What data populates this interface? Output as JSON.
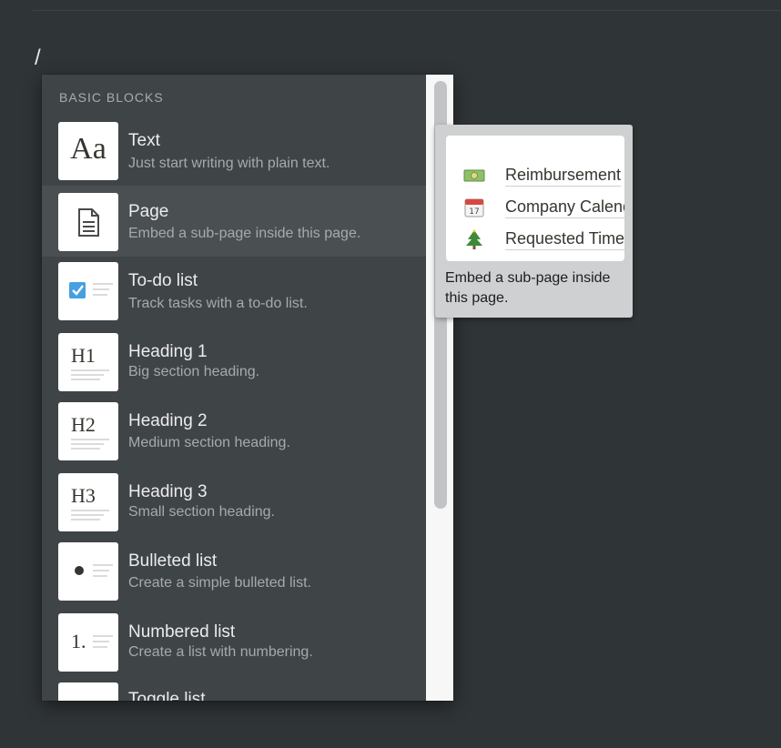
{
  "editor": {
    "slash_text": "/"
  },
  "menu": {
    "section_title": "BASIC BLOCKS",
    "items": [
      {
        "id": "text",
        "label": "Text",
        "description": "Just start writing with plain text.",
        "icon": "text-aa-icon"
      },
      {
        "id": "page",
        "label": "Page",
        "description": "Embed a sub-page inside this page.",
        "icon": "page-document-icon",
        "active": true
      },
      {
        "id": "todo",
        "label": "To-do list",
        "description": "Track tasks with a to-do list.",
        "icon": "checkbox-icon"
      },
      {
        "id": "heading1",
        "label": "Heading 1",
        "description": "Big section heading.",
        "icon": "heading-1-icon",
        "glyph": "H1"
      },
      {
        "id": "heading2",
        "label": "Heading 2",
        "description": "Medium section heading.",
        "icon": "heading-2-icon",
        "glyph": "H2"
      },
      {
        "id": "heading3",
        "label": "Heading 3",
        "description": "Small section heading.",
        "icon": "heading-3-icon",
        "glyph": "H3"
      },
      {
        "id": "bulleted",
        "label": "Bulleted list",
        "description": "Create a simple bulleted list.",
        "icon": "bullet-list-icon"
      },
      {
        "id": "numbered",
        "label": "Numbered list",
        "description": "Create a list with numbering.",
        "icon": "numbered-list-icon",
        "glyph": "1."
      },
      {
        "id": "toggle",
        "label": "Toggle list",
        "description": "",
        "icon": "toggle-list-icon"
      }
    ],
    "text_glyph": "Aa"
  },
  "tooltip": {
    "preview_items": [
      {
        "emoji": "money-icon",
        "text": "Reimbursement"
      },
      {
        "emoji": "calendar-icon",
        "text": "Company Calendar"
      },
      {
        "emoji": "tree-icon",
        "text": "Requested Time"
      }
    ],
    "calendar_day": "17",
    "description": "Embed a sub-page inside this page."
  },
  "colors": {
    "background": "#2f3437",
    "menu_background": "#3f4447",
    "active_row": "#4a4f52",
    "checkbox_blue": "#46a0e0",
    "tooltip_background": "#cfd0d1"
  }
}
